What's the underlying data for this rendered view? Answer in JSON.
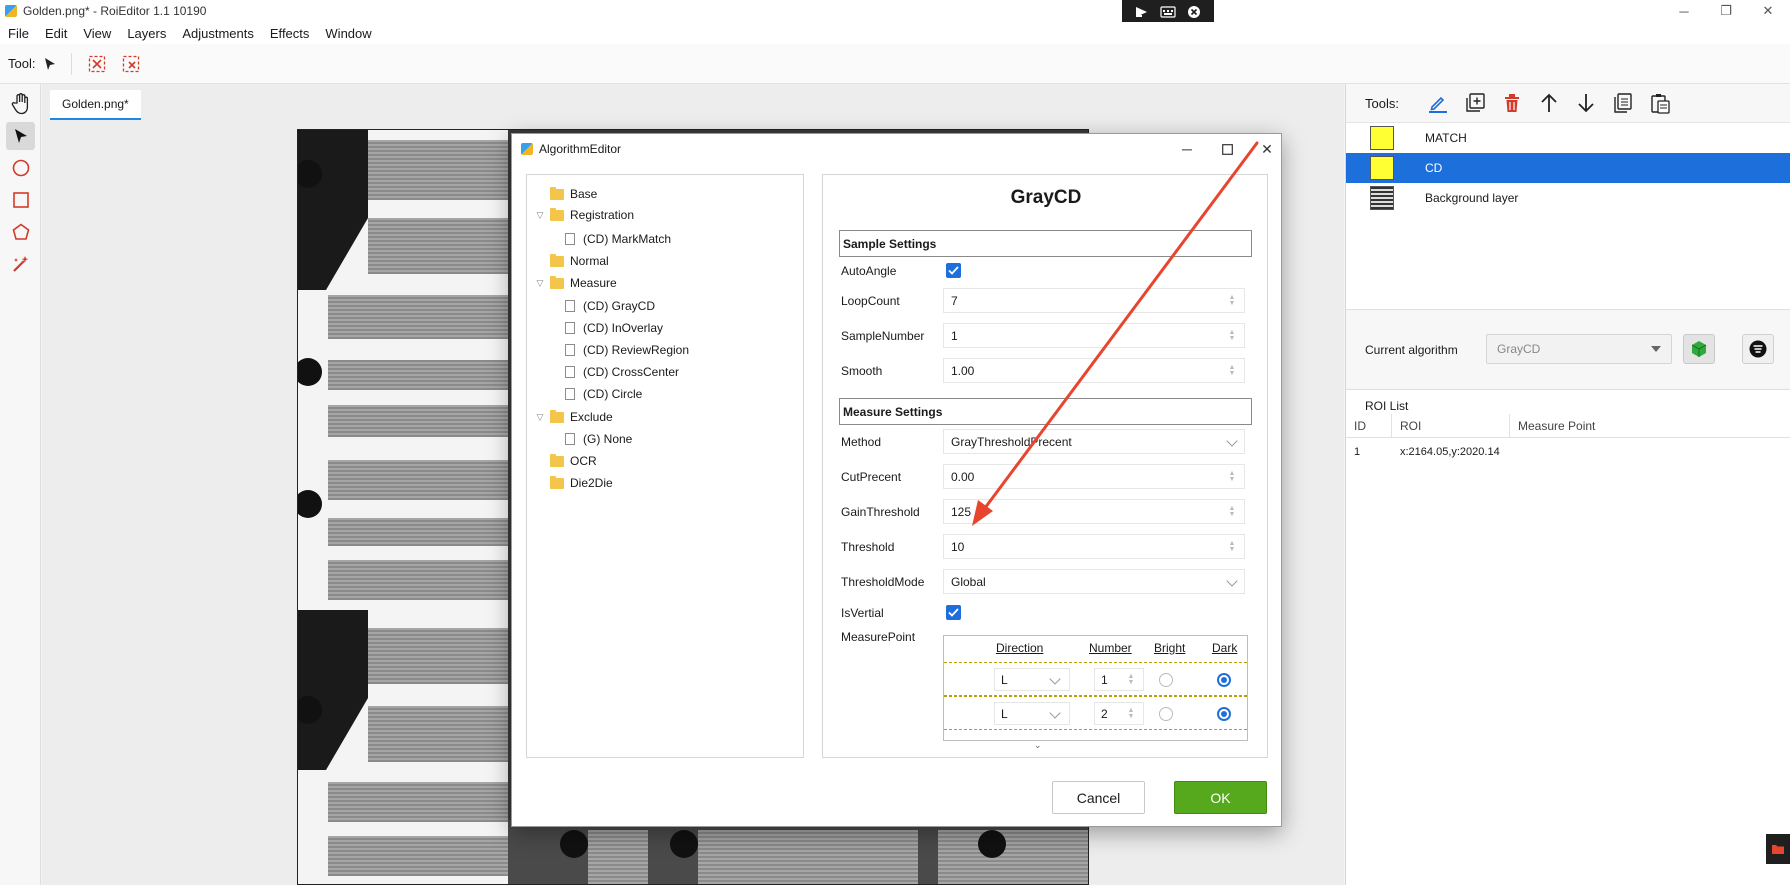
{
  "window": {
    "title": "Golden.png* - RoiEditor 1.1 10190",
    "minimize_glyph": "─",
    "restore_glyph": "❐",
    "close_glyph": "✕"
  },
  "menu": [
    "File",
    "Edit",
    "View",
    "Layers",
    "Adjustments",
    "Effects",
    "Window"
  ],
  "toolbar": {
    "tool_label": "Tool:"
  },
  "canvas": {
    "tab_label": "Golden.png*"
  },
  "right_panel": {
    "tools_label": "Tools:",
    "layers": [
      {
        "name": "MATCH",
        "swatch_color": "#ffff33"
      },
      {
        "name": "CD",
        "swatch_color": "#ffff33"
      },
      {
        "name": "Background layer"
      }
    ],
    "current_algorithm_label": "Current algorithm",
    "current_algorithm_value": "GrayCD",
    "roi_list": {
      "title": "ROI List",
      "columns": [
        "ID",
        "ROI",
        "Measure Point"
      ],
      "rows": [
        {
          "id": "1",
          "roi": "x:2164.05,y:2020.14",
          "measure_point": ""
        }
      ]
    }
  },
  "dialog": {
    "title": "AlgorithmEditor",
    "tree": [
      {
        "label": "Base",
        "type": "folder",
        "depth": 0
      },
      {
        "label": "Registration",
        "type": "folder",
        "depth": 0,
        "expanded": true
      },
      {
        "label": "(CD) MarkMatch",
        "type": "item",
        "depth": 1
      },
      {
        "label": "Normal",
        "type": "folder",
        "depth": 0
      },
      {
        "label": "Measure",
        "type": "folder",
        "depth": 0,
        "expanded": true
      },
      {
        "label": "(CD) GrayCD",
        "type": "item",
        "depth": 1
      },
      {
        "label": "(CD) InOverlay",
        "type": "item",
        "depth": 1
      },
      {
        "label": "(CD) ReviewRegion",
        "type": "item",
        "depth": 1
      },
      {
        "label": "(CD) CrossCenter",
        "type": "item",
        "depth": 1
      },
      {
        "label": "(CD) Circle",
        "type": "item",
        "depth": 1
      },
      {
        "label": "Exclude",
        "type": "folder",
        "depth": 0,
        "expanded": true
      },
      {
        "label": "(G) None",
        "type": "item",
        "depth": 1
      },
      {
        "label": "OCR",
        "type": "folder",
        "depth": 0
      },
      {
        "label": "Die2Die",
        "type": "folder",
        "depth": 0
      }
    ],
    "props": {
      "title": "GrayCD",
      "sample_section": "Sample Settings",
      "auto_angle_label": "AutoAngle",
      "auto_angle_checked": true,
      "loop_count_label": "LoopCount",
      "loop_count": "7",
      "sample_number_label": "SampleNumber",
      "sample_number": "1",
      "smooth_label": "Smooth",
      "smooth": "1.00",
      "measure_section": "Measure Settings",
      "method_label": "Method",
      "method": "GrayThresholdPrecent",
      "cut_precent_label": "CutPrecent",
      "cut_precent": "0.00",
      "gain_threshold_label": "GainThreshold",
      "gain_threshold": "125",
      "threshold_label": "Threshold",
      "threshold": "10",
      "threshold_mode_label": "ThresholdMode",
      "threshold_mode": "Global",
      "is_vertial_label": "IsVertial",
      "is_vertial_checked": true,
      "measure_point_label": "MeasurePoint",
      "measure_point": {
        "columns": [
          "Direction",
          "Number",
          "Bright",
          "Dark"
        ],
        "rows": [
          {
            "direction": "L",
            "number": "1",
            "selected": "Dark"
          },
          {
            "direction": "L",
            "number": "2",
            "selected": "Dark"
          }
        ]
      }
    },
    "cancel_label": "Cancel",
    "ok_label": "OK"
  },
  "colors": {
    "accent_blue": "#1d6fdb",
    "ok_green": "#56a81d",
    "annotation_red": "#e8452f",
    "tool_red": "#d23a2a"
  }
}
